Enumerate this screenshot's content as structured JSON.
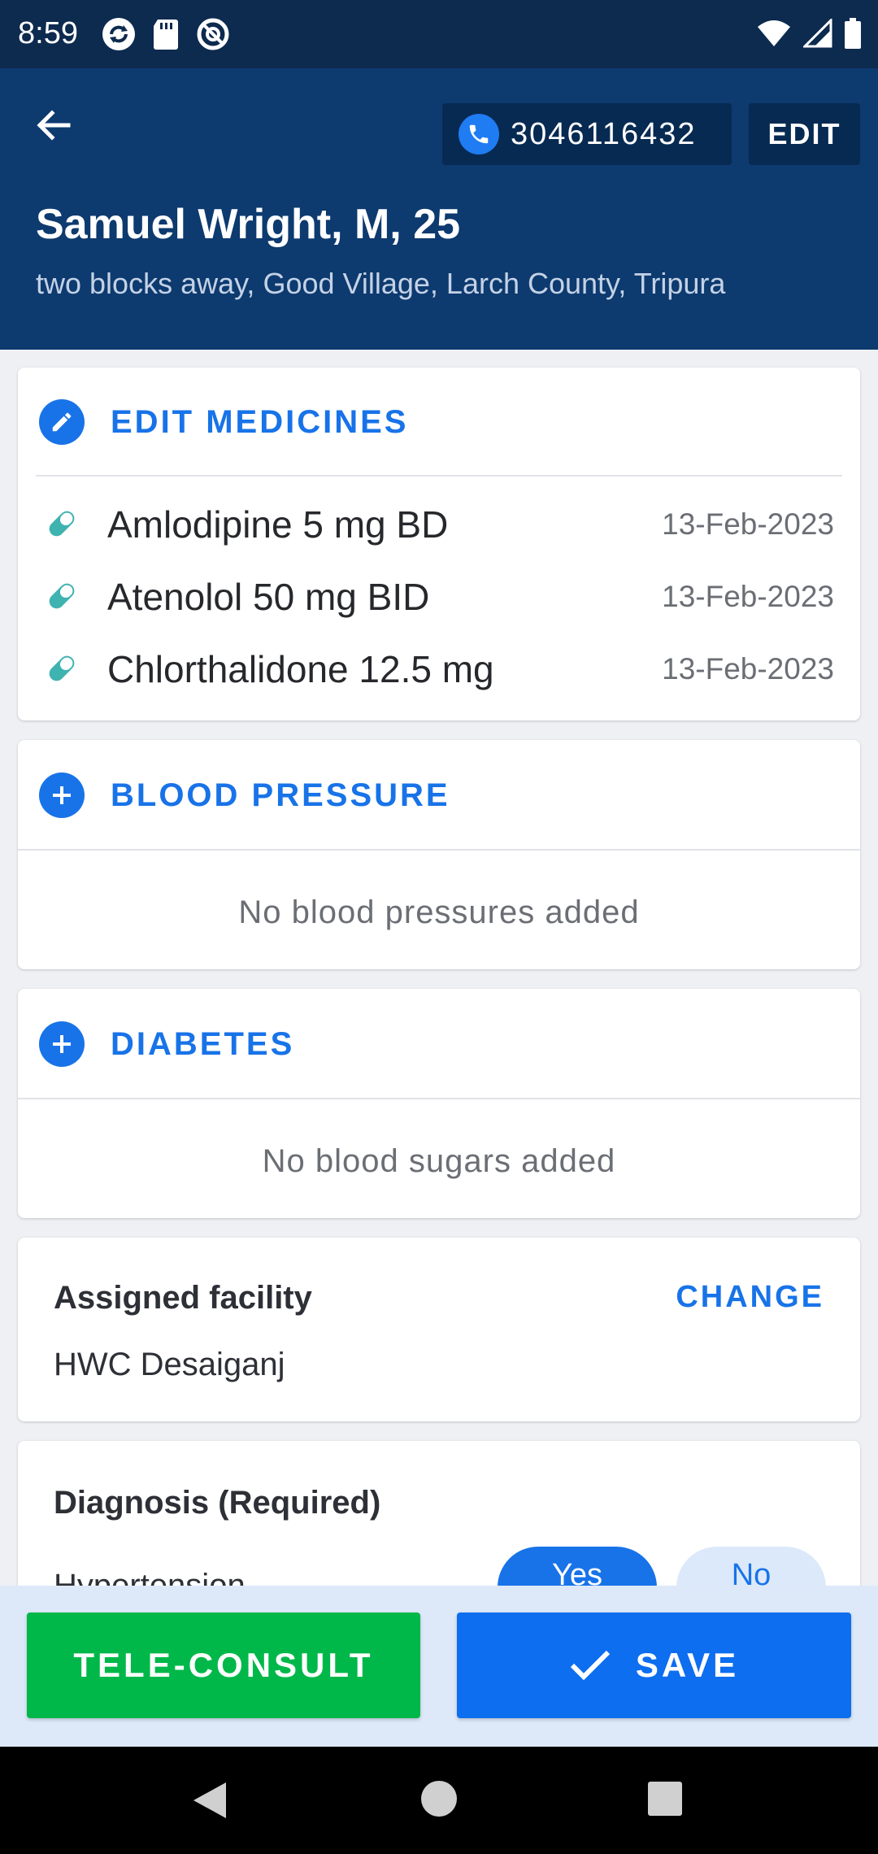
{
  "status_bar": {
    "time": "8:59",
    "left_icons": [
      "sync-icon",
      "sd-card-icon",
      "at-sign-icon"
    ],
    "right_icons": [
      "wifi-icon",
      "signal-icon",
      "battery-icon"
    ]
  },
  "header": {
    "phone_number": "3046116432",
    "edit_label": "EDIT",
    "patient_name": "Samuel Wright, M, 25",
    "address": "two blocks away, Good Village, Larch County, Tripura"
  },
  "medicines": {
    "title": "EDIT MEDICINES",
    "items": [
      {
        "name": "Amlodipine 5 mg BD",
        "date": "13-Feb-2023"
      },
      {
        "name": "Atenolol 50 mg BID",
        "date": "13-Feb-2023"
      },
      {
        "name": "Chlorthalidone 12.5 mg",
        "date": "13-Feb-2023"
      }
    ]
  },
  "blood_pressure": {
    "title": "BLOOD PRESSURE",
    "empty_text": "No blood pressures added"
  },
  "diabetes": {
    "title": "DIABETES",
    "empty_text": "No blood sugars added"
  },
  "facility": {
    "label": "Assigned facility",
    "change_label": "CHANGE",
    "value": "HWC Desaiganj"
  },
  "diagnosis": {
    "label": "Diagnosis (Required)",
    "row_label": "Hypertension",
    "yes_label": "Yes",
    "no_label": "No"
  },
  "actions": {
    "tele_consult_label": "TELE-CONSULT",
    "save_label": "SAVE"
  },
  "colors": {
    "header_bg": "#0d3a6f",
    "status_bg": "#0d2a4f",
    "accent_blue": "#1873e8",
    "pill_teal": "#3fb3b0",
    "tele_green": "#00b849",
    "save_blue": "#0d6ef0"
  }
}
